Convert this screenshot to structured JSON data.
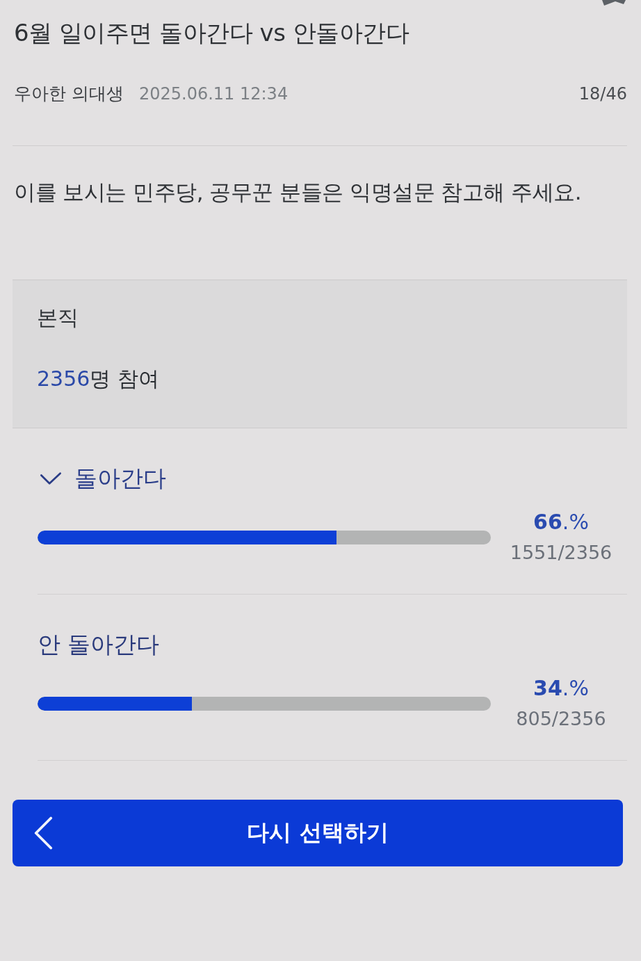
{
  "post": {
    "title": "6월 일이주면 돌아간다 vs 안돌아간다",
    "author": "우아한 의대생",
    "date": "2025.06.11 12:34",
    "position": "18/46",
    "body": "이를 보시는 민주당, 공무꾼 분들은 익명설문 참고해 주세요."
  },
  "poll": {
    "title": "본직",
    "participant_count": "2356",
    "participant_label": "명 참여",
    "options": [
      {
        "label": "돌아간다",
        "selected": true,
        "level": 0.66,
        "percent": "**66**.%",
        "votes": "1551/2356"
      },
      {
        "label": "안 돌아간다",
        "selected": false,
        "level": 0.34,
        "percent": "**34**.%",
        "votes": "805/2356"
      }
    ]
  },
  "button": {
    "label": "다시 선택하기"
  }
}
